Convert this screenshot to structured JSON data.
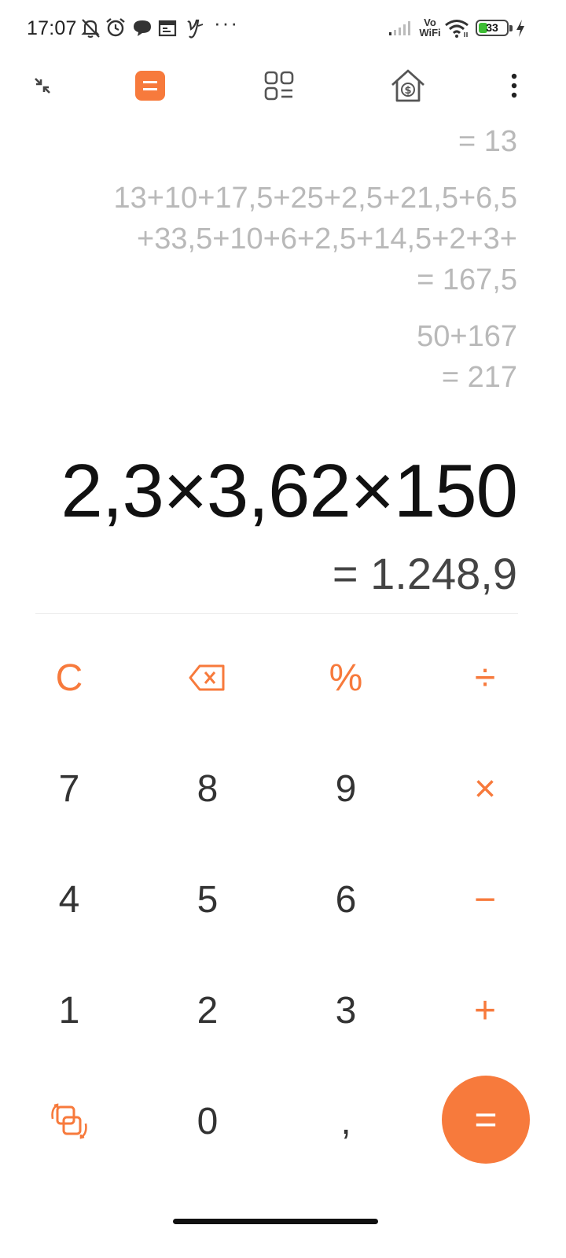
{
  "status_bar": {
    "time": "17:07",
    "overflow": "···",
    "network_label_top": "Vo",
    "network_label_bottom": "WiFi",
    "battery_level": "33",
    "battery_fraction": 0.33,
    "icons": [
      "mute-bell-icon",
      "alarm-icon",
      "chat-icon",
      "calendar-icon",
      "y-app-icon",
      "signal-icon",
      "wifi-icon",
      "battery-icon",
      "charging-icon"
    ]
  },
  "toolbar": {
    "icons": [
      "collapse-icon",
      "calculator-icon",
      "converter-grid-icon",
      "mortgage-icon",
      "more-menu-icon"
    ],
    "active": "calculator-icon"
  },
  "history": [
    {
      "lines": [
        "= 13"
      ]
    },
    {
      "lines": [
        "13+10+17,5+25+2,5+21,5+6,5",
        "+33,5+10+6+2,5+14,5+2+3+",
        "= 167,5"
      ]
    },
    {
      "lines": [
        "50+167",
        "= 217"
      ]
    }
  ],
  "display": {
    "expression": "2,3×3,62×150",
    "result": "= 1.248,9"
  },
  "keypad": {
    "clear": "C",
    "percent": "%",
    "divide": "÷",
    "multiply": "×",
    "minus": "−",
    "plus": "+",
    "equals": "=",
    "decimal": ",",
    "digits": [
      "7",
      "8",
      "9",
      "4",
      "5",
      "6",
      "1",
      "2",
      "3",
      "0"
    ],
    "icons": [
      "backspace-icon",
      "swap-mode-icon"
    ]
  },
  "colors": {
    "accent": "#f77a3c",
    "text": "#333333",
    "history_text": "#b9b9b9",
    "background": "#ffffff"
  }
}
